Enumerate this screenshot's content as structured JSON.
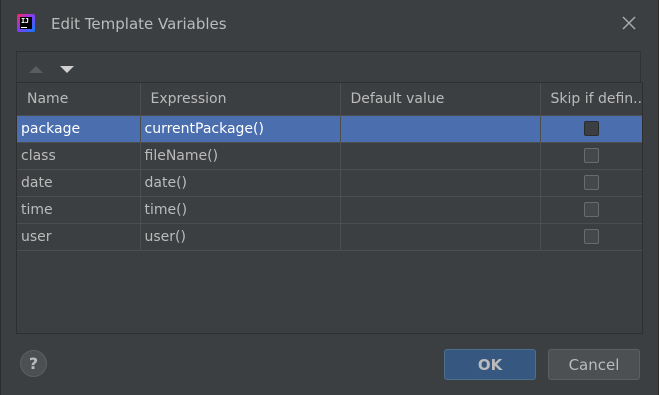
{
  "window": {
    "title": "Edit Template Variables",
    "app_icon": "intellij-idea-icon",
    "app_icon_text": "IJ"
  },
  "toolbar": {
    "move_up_icon": "arrow-up-icon",
    "move_down_icon": "arrow-down-icon"
  },
  "table": {
    "headers": [
      "Name",
      "Expression",
      "Default value",
      "Skip if defin..."
    ],
    "rows": [
      {
        "name": "package",
        "expression": "currentPackage()",
        "default_value": "",
        "skip_if_defined": false,
        "selected": true
      },
      {
        "name": "class",
        "expression": "fileName()",
        "default_value": "",
        "skip_if_defined": false,
        "selected": false
      },
      {
        "name": "date",
        "expression": "date()",
        "default_value": "",
        "skip_if_defined": false,
        "selected": false
      },
      {
        "name": "time",
        "expression": "time()",
        "default_value": "",
        "skip_if_defined": false,
        "selected": false
      },
      {
        "name": "user",
        "expression": "user()",
        "default_value": "",
        "skip_if_defined": false,
        "selected": false
      }
    ]
  },
  "footer": {
    "help_label": "?",
    "ok_label": "OK",
    "cancel_label": "Cancel"
  },
  "colors": {
    "background": "#3c3f41",
    "selection": "#4b6eaf",
    "default_button": "#365880"
  }
}
